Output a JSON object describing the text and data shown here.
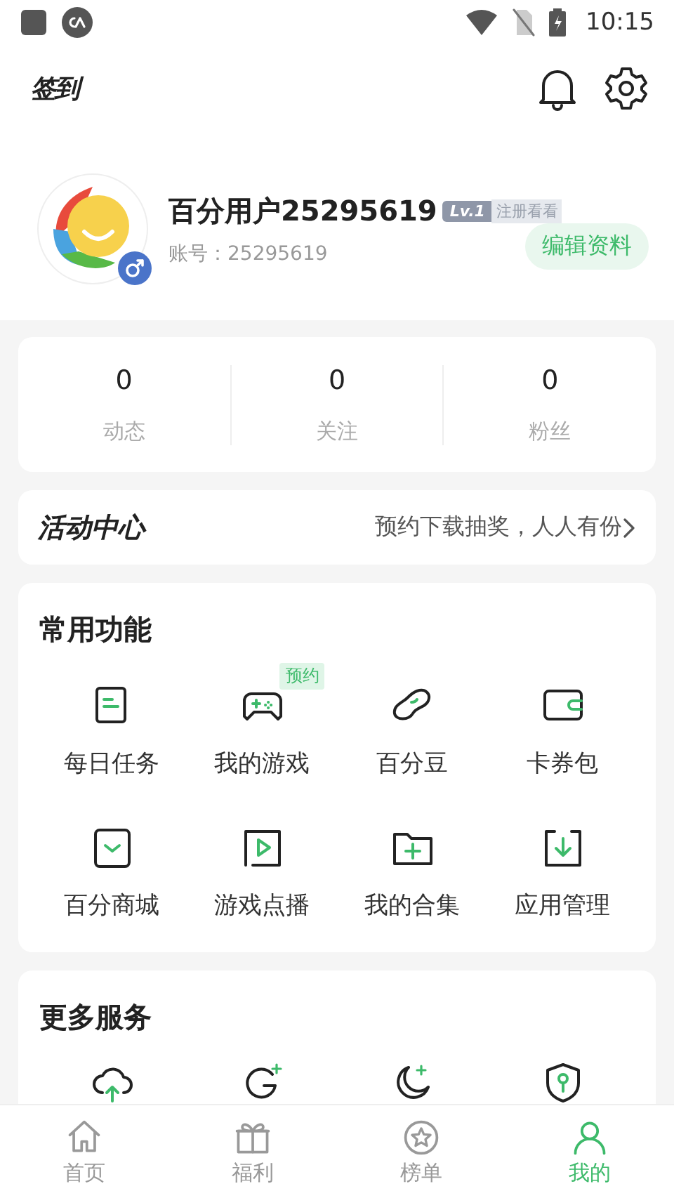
{
  "status_bar": {
    "time": "10:15"
  },
  "header": {
    "checkin": "签到"
  },
  "profile": {
    "name": "百分用户25295619",
    "level": "Lv.1",
    "tag": "注册看看",
    "account": "账号：25295619",
    "edit_button": "编辑资料"
  },
  "stats": [
    {
      "value": "0",
      "label": "动态"
    },
    {
      "value": "0",
      "label": "关注"
    },
    {
      "value": "0",
      "label": "粉丝"
    }
  ],
  "activity": {
    "title": "活动中心",
    "promo": "预约下载抽奖，人人有份"
  },
  "common_functions": {
    "title": "常用功能",
    "items": [
      {
        "label": "每日任务"
      },
      {
        "label": "我的游戏",
        "badge": "预约"
      },
      {
        "label": "百分豆"
      },
      {
        "label": "卡券包"
      },
      {
        "label": "百分商城"
      },
      {
        "label": "游戏点播"
      },
      {
        "label": "我的合集"
      },
      {
        "label": "应用管理"
      }
    ]
  },
  "more_services": {
    "title": "更多服务"
  },
  "tabs": [
    {
      "label": "首页",
      "selected": false
    },
    {
      "label": "福利",
      "selected": false
    },
    {
      "label": "榜单",
      "selected": false
    },
    {
      "label": "我的",
      "selected": true
    }
  ]
}
